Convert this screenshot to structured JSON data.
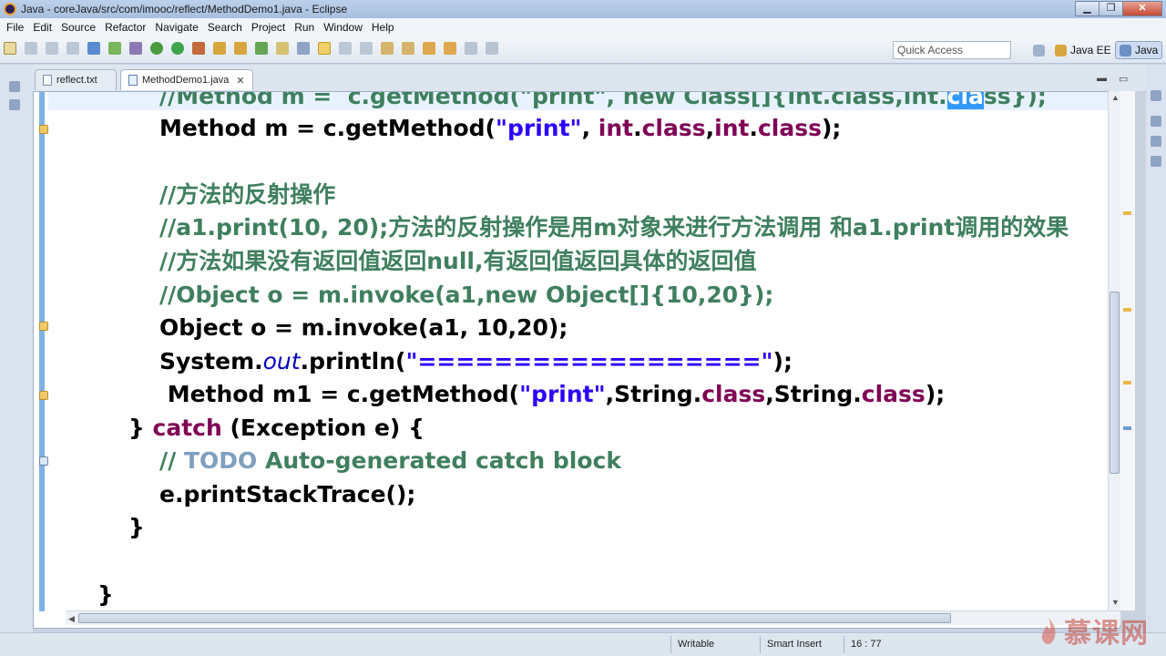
{
  "window": {
    "title": "Java - coreJava/src/com/imooc/reflect/MethodDemo1.java - Eclipse",
    "controls": {
      "minimize": "▁",
      "maximize": "❐",
      "close": "✕"
    }
  },
  "menu": [
    "File",
    "Edit",
    "Source",
    "Refactor",
    "Navigate",
    "Search",
    "Project",
    "Run",
    "Window",
    "Help"
  ],
  "toolbar": {
    "quick_access_placeholder": "Quick Access",
    "perspectives": [
      "Java EE",
      "Java"
    ]
  },
  "tabs": [
    {
      "label": "reflect.txt",
      "active": false
    },
    {
      "label": "MethodDemo1.java",
      "active": true,
      "close": "✕"
    }
  ],
  "editor": {
    "lines": [
      "//Method m =  c.getMethod(\"print\", new Class[]{int.class,int.class});",
      "Method m = c.getMethod(\"print\", int.class,int.class);",
      "//方法的反射操作",
      "//a1.print(10, 20);方法的反射操作是用m对象来进行方法调用 和a1.print调用的效果",
      "//方法如果没有返回值返回null,有返回值返回具体的返回值",
      "//Object o = m.invoke(a1,new Object[]{10,20});",
      "Object o = m.invoke(a1, 10,20);",
      "System.out.println(\"==================\");",
      " Method m1 = c.getMethod(\"print\",String.class,String.class);",
      "} catch (Exception e) {",
      "// TODO Auto-generated catch block",
      "e.printStackTrace();",
      "}",
      "}"
    ]
  },
  "statusbar": {
    "mode": "Writable",
    "insert": "Smart Insert",
    "position": "16 : 77"
  },
  "watermark": "慕课网",
  "colors": {
    "keyword": "#7f0055",
    "string": "#2a00ff",
    "comment": "#3f7f5f",
    "todo": "#7f9fbf",
    "field": "#0000c0",
    "selection": "#3399ff"
  }
}
